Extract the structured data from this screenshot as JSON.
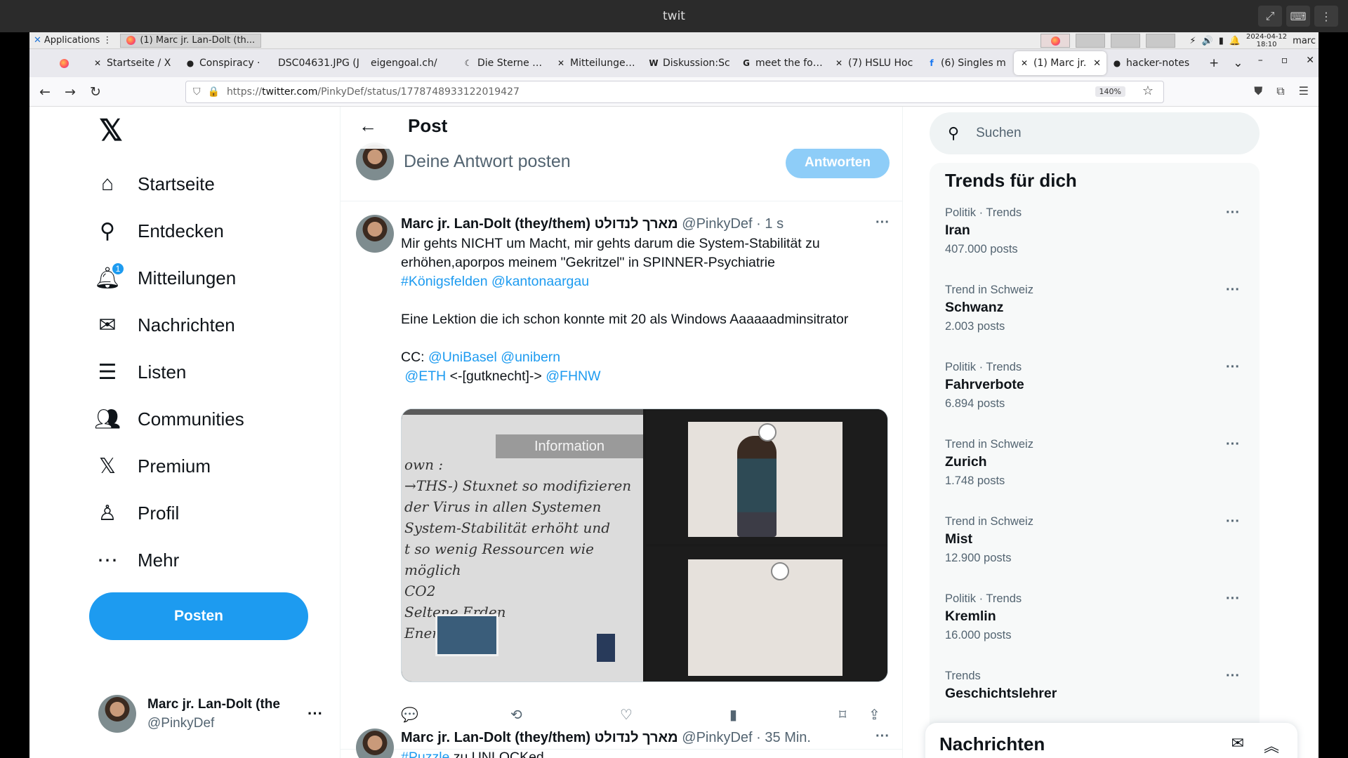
{
  "window": {
    "title": "twit"
  },
  "panel": {
    "applications_label": "Applications",
    "task_label": "(1) Marc jr. Lan-Dolt (th...",
    "date": "2024-04-12",
    "time": "18:10",
    "user": "marc"
  },
  "tabs": [
    {
      "label": "",
      "icon": "firefox-icon"
    },
    {
      "label": "Startseite / X",
      "icon": "x-icon"
    },
    {
      "label": "Conspiracy · ",
      "icon": "github-icon"
    },
    {
      "label": "DSC04631.JPG (J",
      "icon": ""
    },
    {
      "label": "eigengoal.ch/",
      "icon": ""
    },
    {
      "label": "Die Sterne - T",
      "icon": "moon-icon"
    },
    {
      "label": "Mitteilungen / ",
      "icon": "x-icon"
    },
    {
      "label": "Diskussion:Sc",
      "icon": "wikipedia-icon"
    },
    {
      "label": "meet the fock",
      "icon": "google-icon"
    },
    {
      "label": "(7) HSLU Hoc",
      "icon": "x-icon"
    },
    {
      "label": "(6) Singles m",
      "icon": "facebook-icon"
    },
    {
      "label": "(1) Marc jr.",
      "icon": "x-icon",
      "active": true
    },
    {
      "label": "hacker-notes",
      "icon": "github-icon"
    }
  ],
  "nav": {
    "url_prefix": "https://",
    "url_host": "twitter.com",
    "url_path": "/PinkyDef/status/1778748933122019427",
    "zoom": "140%"
  },
  "sidebar": {
    "items": [
      {
        "label": "Startseite",
        "icon": "home-icon"
      },
      {
        "label": "Entdecken",
        "icon": "search-icon"
      },
      {
        "label": "Mitteilungen",
        "icon": "bell-icon",
        "badge": "1"
      },
      {
        "label": "Nachrichten",
        "icon": "mail-icon"
      },
      {
        "label": "Listen",
        "icon": "list-icon"
      },
      {
        "label": "Communities",
        "icon": "communities-icon"
      },
      {
        "label": "Premium",
        "icon": "x-logo-icon"
      },
      {
        "label": "Profil",
        "icon": "person-icon"
      },
      {
        "label": "Mehr",
        "icon": "more-circle-icon"
      }
    ],
    "post_button": "Posten",
    "account": {
      "name": "Marc jr. Lan-Dolt (the",
      "handle": "@PinkyDef"
    }
  },
  "main": {
    "header_title": "Post",
    "reply_placeholder": "Deine Antwort posten",
    "reply_button": "Antworten",
    "tweet": {
      "author": "Marc jr. Lan-Dolt (they/them) מארך לנדולט",
      "handle": "@PinkyDef",
      "time": "· 1 s",
      "line1": "Mir gehts NICHT um Macht, mir gehts darum die System-Stabilität zu erhöhen,aporpos meinem \"Gekritzel\" in SPINNER-Psychiatrie",
      "tag1": "#Königsfelden",
      "mention1": "@kantonaargau",
      "line2": "Eine Lektion die ich schon konnte mit 20 als Windows Aaaaaadminsitrator",
      "cc_label": "CC:",
      "mention2": "@UniBasel",
      "mention3": "@unibern",
      "mention4": "@ETH",
      "mid_text": "<-[gutknecht]->",
      "mention5": "@FHNW",
      "image1_header": "Information",
      "image1_lines": [
        "own :",
        "→THS-) Stuxnet  so modifizieren",
        "  der  Virus  in allen Systemen",
        "System-Stabilität erhöht und",
        "t  so wenig Ressourcen wie möglich",
        "CO2",
        "Seltene Erden",
        "Energie"
      ]
    },
    "tweet2": {
      "author": "Marc jr. Lan-Dolt (they/them) מארך לנדולט",
      "handle": "@PinkyDef",
      "time": "· 35 Min.",
      "tag": "#Puzzle",
      "text": " zu UNLOCKed"
    }
  },
  "right": {
    "search_placeholder": "Suchen",
    "trends_title": "Trends für dich",
    "trends": [
      {
        "category": "Politik · Trends",
        "name": "Iran",
        "count": "407.000 posts"
      },
      {
        "category": "Trend in Schweiz",
        "name": "Schwanz",
        "count": "2.003 posts"
      },
      {
        "category": "Politik · Trends",
        "name": "Fahrverbote",
        "count": "6.894 posts"
      },
      {
        "category": "Trend in Schweiz",
        "name": "Zurich",
        "count": "1.748 posts"
      },
      {
        "category": "Trend in Schweiz",
        "name": "Mist",
        "count": "12.900 posts"
      },
      {
        "category": "Politik · Trends",
        "name": "Kremlin",
        "count": "16.000 posts"
      },
      {
        "category": "Trends",
        "name": "Geschichtslehrer",
        "count": ""
      }
    ],
    "messages_title": "Nachrichten"
  },
  "colors": {
    "accent": "#1d9bf0",
    "text": "#0f1419",
    "muted": "#536471"
  }
}
